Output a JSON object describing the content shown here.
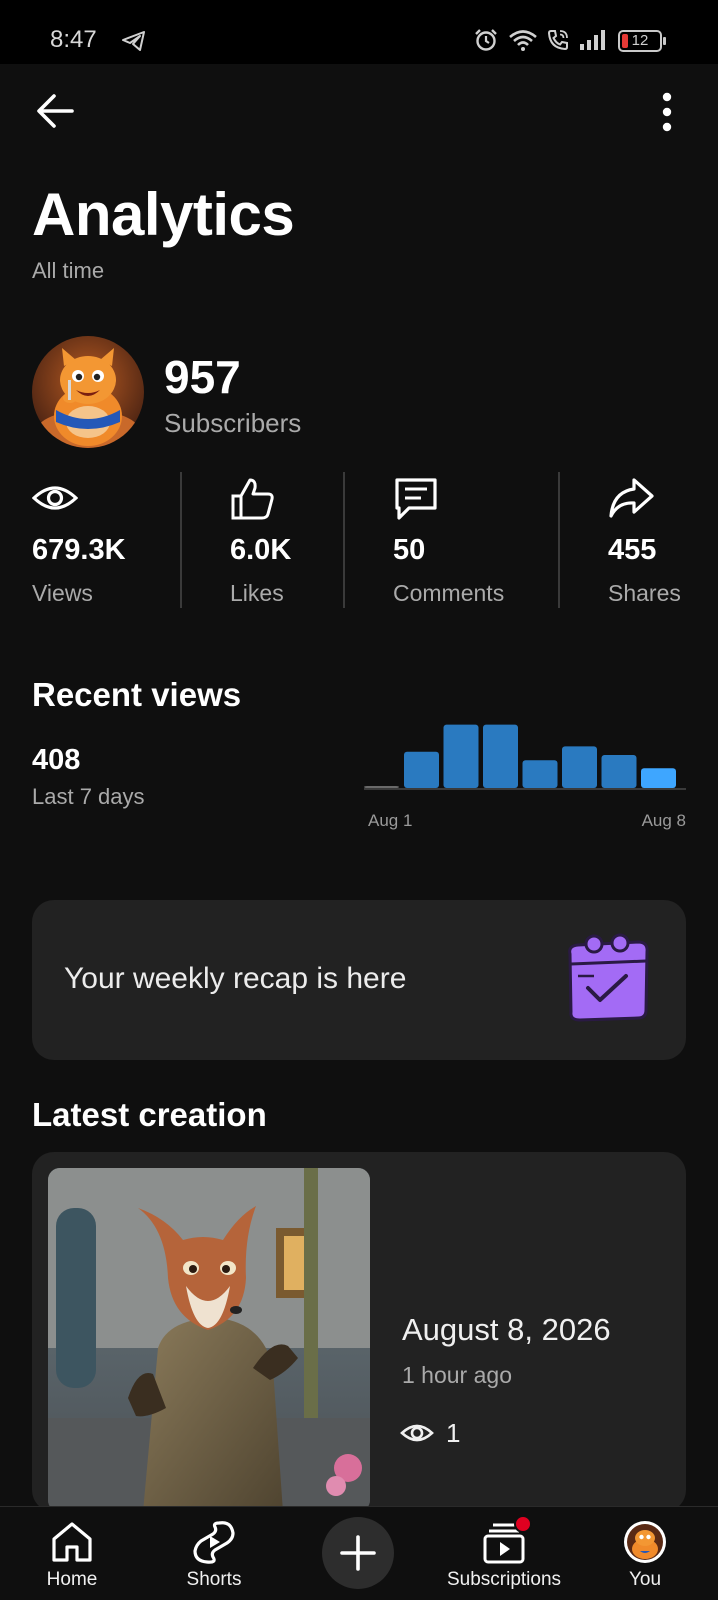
{
  "status_bar": {
    "time": "8:47",
    "battery": "12",
    "battery_color": "#e53935",
    "icons": [
      "telegram-icon",
      "alarm-icon",
      "wifi-icon",
      "wifi-call-icon",
      "signal-icon",
      "battery-icon"
    ]
  },
  "header": {
    "back_icon": "arrow-left-icon",
    "more_icon": "more-vert-icon"
  },
  "page": {
    "title": "Analytics",
    "subtitle": "All time"
  },
  "channel": {
    "subscribers_value": "957",
    "subscribers_label": "Subscribers"
  },
  "stats": [
    {
      "icon": "eye-icon",
      "value": "679.3K",
      "label": "Views"
    },
    {
      "icon": "thumbs-up-icon",
      "value": "6.0K",
      "label": "Likes"
    },
    {
      "icon": "comment-icon",
      "value": "50",
      "label": "Comments"
    },
    {
      "icon": "share-icon",
      "value": "455",
      "label": "Shares"
    }
  ],
  "recent_views": {
    "title": "Recent views",
    "value": "408",
    "label": "Last 7 days",
    "x_start": "Aug 1",
    "x_end": "Aug 8"
  },
  "chart_data": {
    "type": "bar",
    "categories": [
      "Aug 1",
      "Aug 2",
      "Aug 3",
      "Aug 4",
      "Aug 5",
      "Aug 6",
      "Aug 7",
      "Aug 8"
    ],
    "values": [
      0,
      55,
      96,
      96,
      42,
      63,
      50,
      30
    ],
    "title": "",
    "xlabel": "",
    "ylabel": "",
    "ylim": [
      0,
      100
    ],
    "tick_labels": [
      "Aug 1",
      "Aug 8"
    ],
    "bar_color": "#2a7ac0",
    "highlight_color": "#3ea6ff",
    "grid": false
  },
  "recap": {
    "text": "Your weekly recap is here",
    "icon": "calendar-check-icon",
    "icon_color": "#a36bf5"
  },
  "latest": {
    "title": "Latest creation",
    "date": "August 8, 2026",
    "time_ago": "1 hour ago",
    "views": "1"
  },
  "nav": {
    "home": "Home",
    "shorts": "Shorts",
    "subscriptions": "Subscriptions",
    "you": "You",
    "badge_color": "#e00020"
  }
}
